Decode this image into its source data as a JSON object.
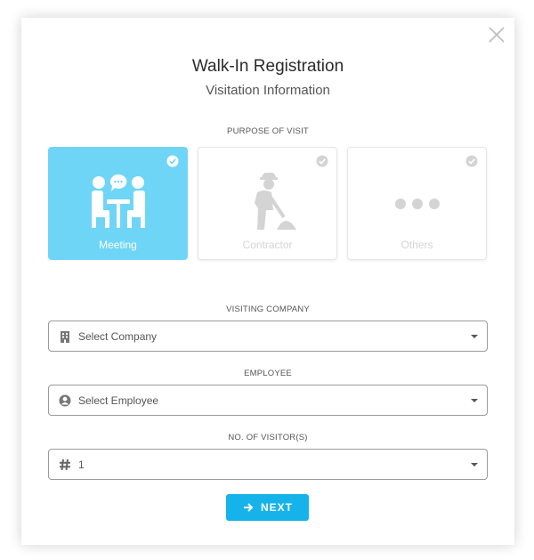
{
  "dialog": {
    "title": "Walk-In Registration",
    "subtitle": "Visitation Information",
    "close_icon": "close-icon"
  },
  "purpose": {
    "label": "PURPOSE OF VISIT",
    "options": [
      {
        "label": "Meeting",
        "icon": "meeting-icon",
        "selected": true
      },
      {
        "label": "Contractor",
        "icon": "contractor-icon",
        "selected": false
      },
      {
        "label": "Others",
        "icon": "ellipsis-icon",
        "selected": false
      }
    ]
  },
  "company": {
    "label": "VISITING COMPANY",
    "placeholder": "Select Company",
    "icon": "building-icon"
  },
  "employee": {
    "label": "EMPLOYEE",
    "placeholder": "Select Employee",
    "icon": "user-circle-icon"
  },
  "visitors": {
    "label": "NO. OF VISITOR(S)",
    "value": "1",
    "icon": "hash-icon"
  },
  "next_button": {
    "label": "NEXT",
    "icon": "arrow-right-icon"
  },
  "colors": {
    "accent": "#16b3ea",
    "selected_card": "#6fd5f7",
    "unselected_icon": "#d4d4d4"
  }
}
